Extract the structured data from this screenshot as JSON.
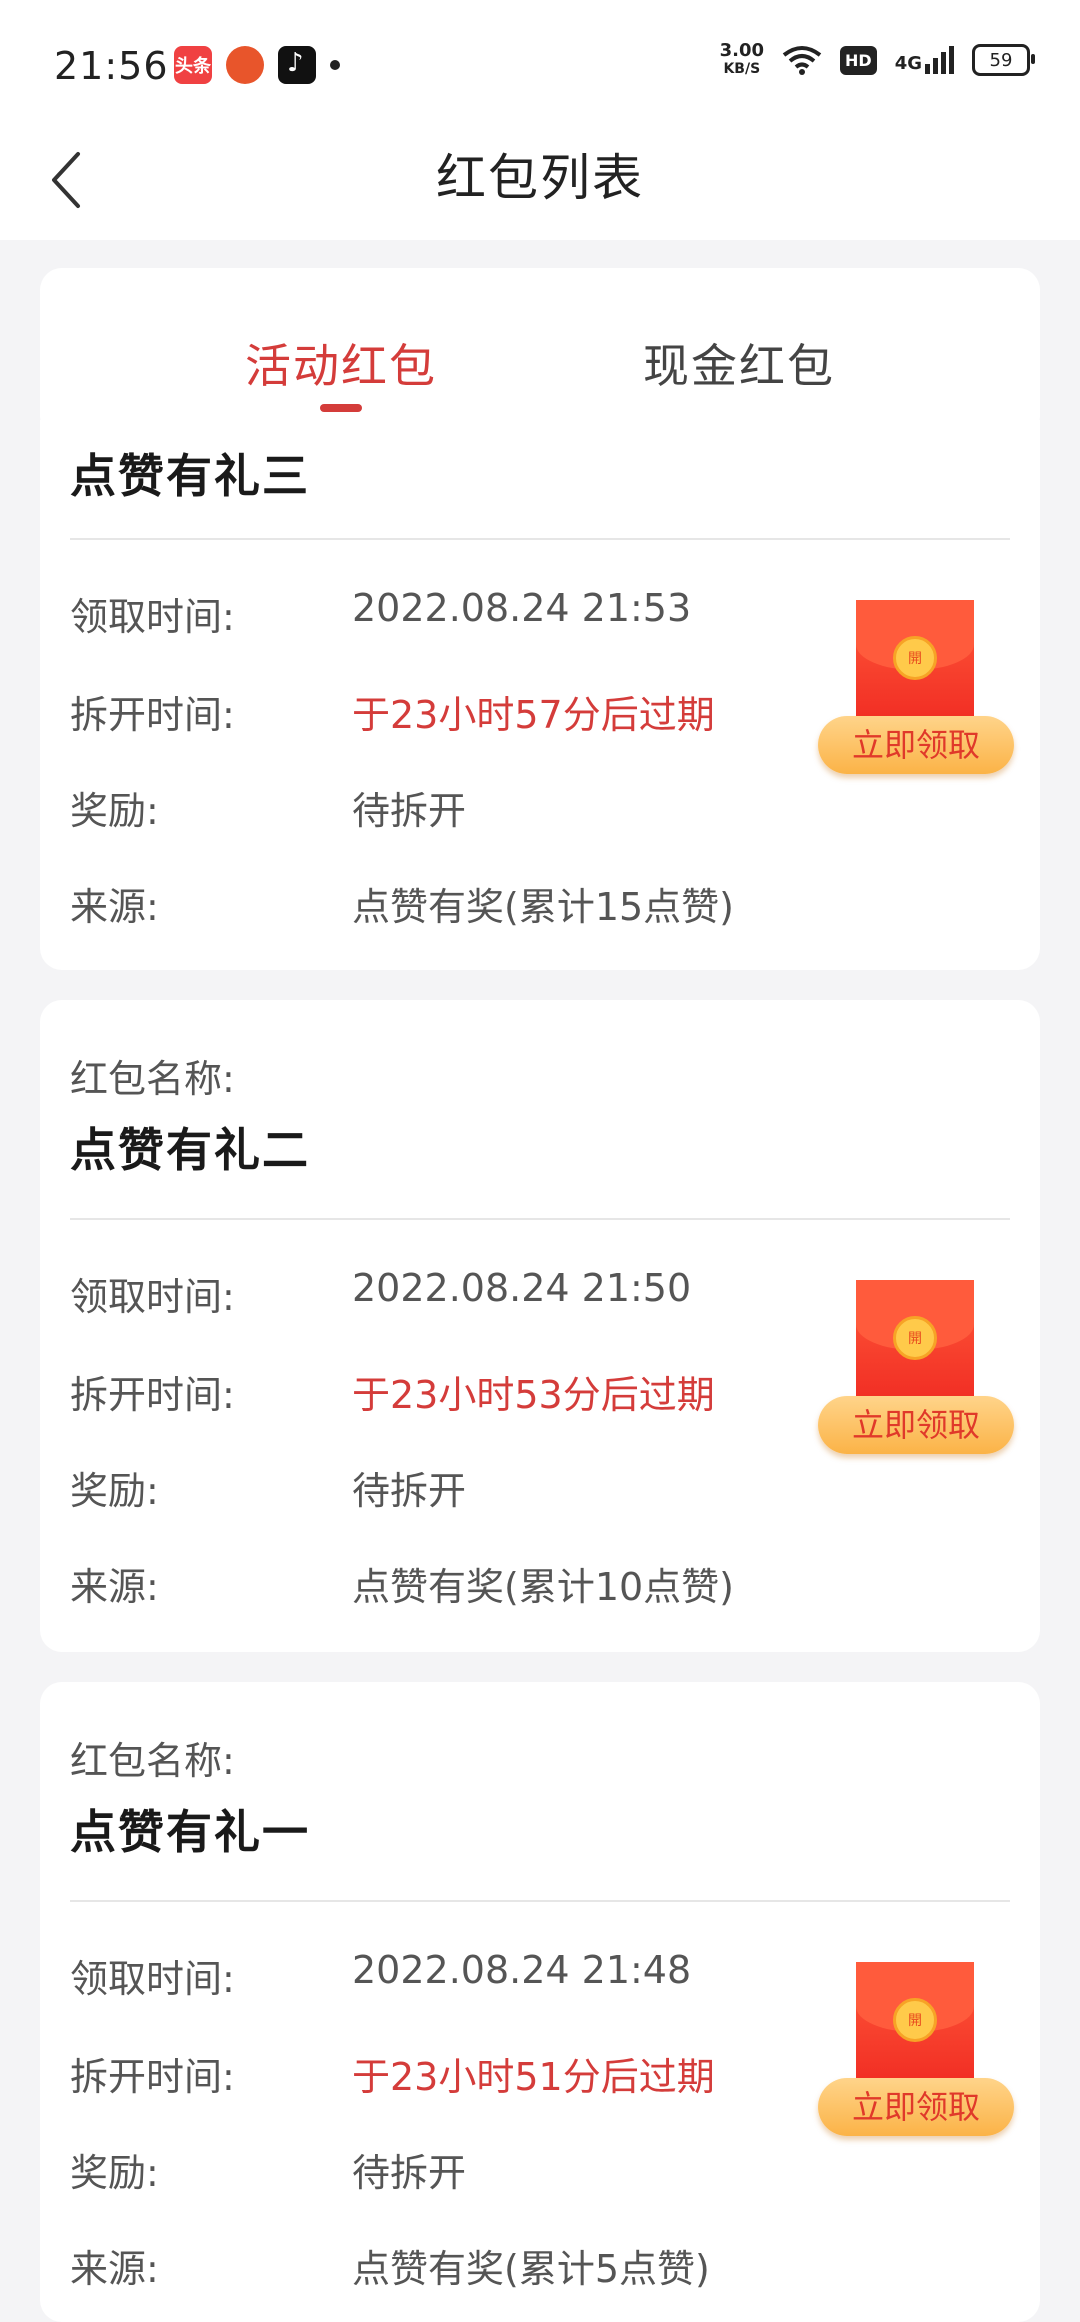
{
  "status_bar": {
    "time": "21:56",
    "app_toutiao": "头条",
    "net_speed_value": "3.00",
    "net_speed_unit": "KB/S",
    "hd": "HD",
    "signal": "4G",
    "battery": "59"
  },
  "nav": {
    "title": "红包列表"
  },
  "tabs": [
    {
      "label": "活动红包",
      "active": true
    },
    {
      "label": "现金红包",
      "active": false
    }
  ],
  "labels": {
    "name_label": "红包名称:",
    "receive_time": "领取时间:",
    "open_time": "拆开时间:",
    "reward": "奖励:",
    "source": "来源:",
    "claim_button": "立即领取",
    "seal_char": "開"
  },
  "envelopes": [
    {
      "name": "点赞有礼三",
      "receive_time": "2022.08.24 21:53",
      "open_time": "于23小时57分后过期",
      "reward": "待拆开",
      "source": "点赞有奖(累计15点赞)"
    },
    {
      "name": "点赞有礼二",
      "receive_time": "2022.08.24 21:50",
      "open_time": "于23小时53分后过期",
      "reward": "待拆开",
      "source": "点赞有奖(累计10点赞)"
    },
    {
      "name": "点赞有礼一",
      "receive_time": "2022.08.24 21:48",
      "open_time": "于23小时51分后过期",
      "reward": "待拆开",
      "source": "点赞有奖(累计5点赞)"
    }
  ],
  "colors": {
    "accent_red": "#d43c3a",
    "background": "#f4f4f6"
  }
}
